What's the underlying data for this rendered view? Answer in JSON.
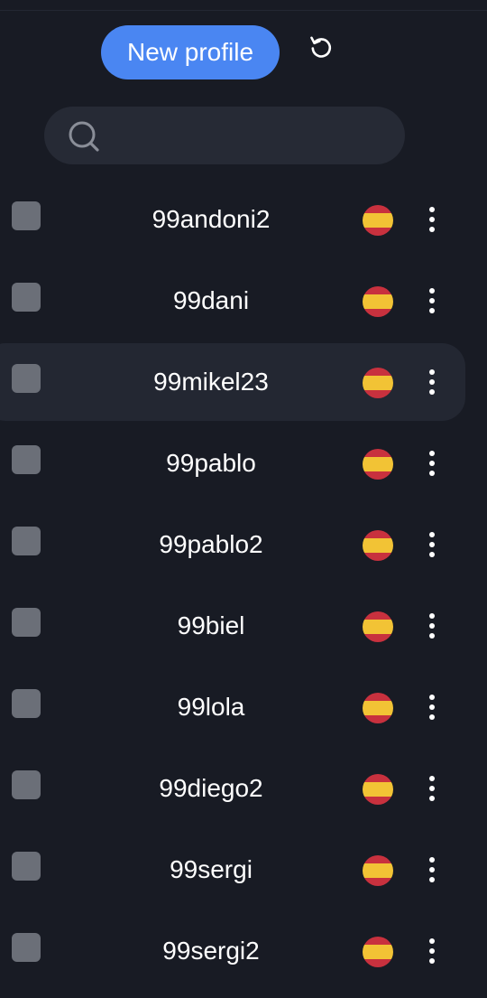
{
  "header": {
    "new_profile_label": "New profile",
    "refresh_icon": "refresh-icon"
  },
  "search": {
    "placeholder": "",
    "value": "",
    "icon": "search-icon"
  },
  "colors": {
    "background": "#181b24",
    "accent": "#4a86f2",
    "search_bg": "#262a35",
    "selected_row_bg": "#232732",
    "checkbox": "#6b6f78",
    "flag_red": "#c8313e",
    "flag_yellow": "#f2c335"
  },
  "profiles": [
    {
      "name": "99andoni2",
      "flag": "spain-flag-icon",
      "selected": false
    },
    {
      "name": "99dani",
      "flag": "spain-flag-icon",
      "selected": false
    },
    {
      "name": "99mikel23",
      "flag": "spain-flag-icon",
      "selected": true
    },
    {
      "name": "99pablo",
      "flag": "spain-flag-icon",
      "selected": false
    },
    {
      "name": "99pablo2",
      "flag": "spain-flag-icon",
      "selected": false
    },
    {
      "name": "99biel",
      "flag": "spain-flag-icon",
      "selected": false
    },
    {
      "name": "99lola",
      "flag": "spain-flag-icon",
      "selected": false
    },
    {
      "name": "99diego2",
      "flag": "spain-flag-icon",
      "selected": false
    },
    {
      "name": "99sergi",
      "flag": "spain-flag-icon",
      "selected": false
    },
    {
      "name": "99sergi2",
      "flag": "spain-flag-icon",
      "selected": false
    }
  ]
}
